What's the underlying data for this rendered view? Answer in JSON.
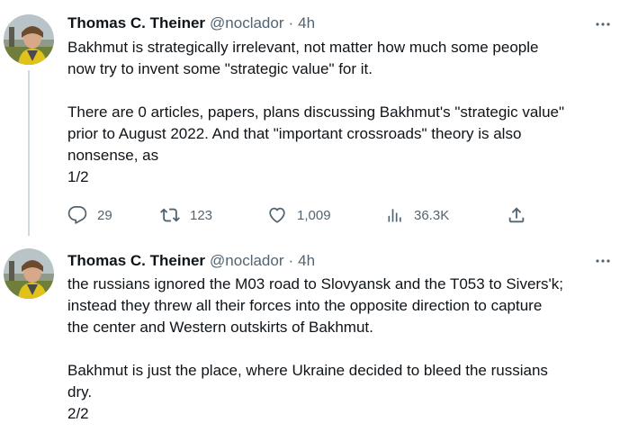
{
  "colors": {
    "text_primary": "#0f1419",
    "text_secondary": "#536471",
    "thread_line": "#cfd9de"
  },
  "tweets": [
    {
      "display_name": "Thomas C. Theiner",
      "handle": "@noclador",
      "separator": "·",
      "time": "4h",
      "avatar_icon": "avatar-photo",
      "menu_icon": "more-horizontal-icon",
      "lines": [
        "Bakhmut is strategically irrelevant, not matter how much some people",
        "now try to invent some \"strategic value\" for it.",
        "",
        "There are 0 articles, papers, plans discussing Bakhmut's \"strategic value\"",
        "prior to August 2022. And that \"important crossroads\" theory is also",
        "nonsense, as",
        "1/2"
      ],
      "replies": "29",
      "retweets": "123",
      "likes": "1,009",
      "views": "36.3K"
    },
    {
      "display_name": "Thomas C. Theiner",
      "handle": "@noclador",
      "separator": "·",
      "time": "4h",
      "avatar_icon": "avatar-photo",
      "menu_icon": "more-horizontal-icon",
      "lines": [
        "the russians ignored the M03 road to Slovyansk and the T053 to Sivers'k;",
        "instead they threw all their forces into the opposite direction to capture",
        "the center and Western outskirts of Bakhmut.",
        "",
        "Bakhmut is just the place, where Ukraine decided to bleed the russians",
        "dry.",
        "2/2"
      ]
    }
  ]
}
